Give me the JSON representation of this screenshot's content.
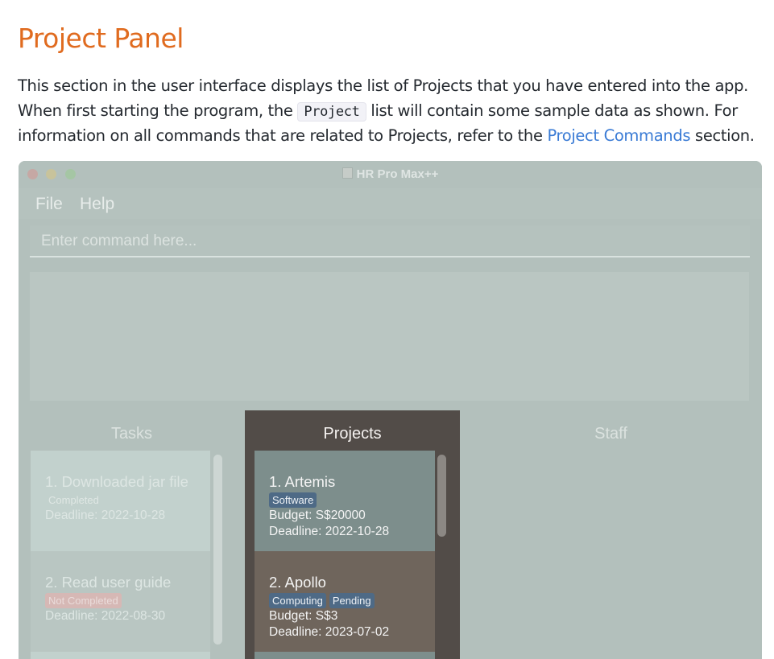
{
  "doc": {
    "title": "Project Panel",
    "para_part1": "This section in the user interface displays the list of Projects that you have entered into the app. When first starting the program, the ",
    "code": "Project",
    "para_part2": " list will contain some sample data as shown. For information on all commands that are related to Projects, refer to the ",
    "link": "Project Commands",
    "para_part3": " section."
  },
  "app": {
    "window_title": "HR Pro Max++",
    "menu": [
      "File",
      "Help"
    ],
    "command_placeholder": "Enter command here...",
    "columns": {
      "tasks": "Tasks",
      "projects": "Projects",
      "staff": "Staff"
    },
    "tasks": [
      {
        "title": "1.  Downloaded jar file",
        "status": "Completed",
        "deadline": "Deadline: 2022-10-28"
      },
      {
        "title": "2.  Read user guide",
        "status": "Not Completed",
        "deadline": "Deadline: 2022-08-30"
      }
    ],
    "projects": [
      {
        "title": "1.  Artemis",
        "tags": [
          "Software"
        ],
        "budget": "Budget: S$20000",
        "deadline": "Deadline: 2022-10-28"
      },
      {
        "title": "2.  Apollo",
        "tags": [
          "Computing",
          "Pending"
        ],
        "budget": "Budget: S$3",
        "deadline": "Deadline: 2023-07-02"
      }
    ]
  },
  "colors": {
    "heading": "#e06b1f",
    "link": "#3a7bd5",
    "projects_panel": "#524c48",
    "tag": "#4e6a86"
  }
}
